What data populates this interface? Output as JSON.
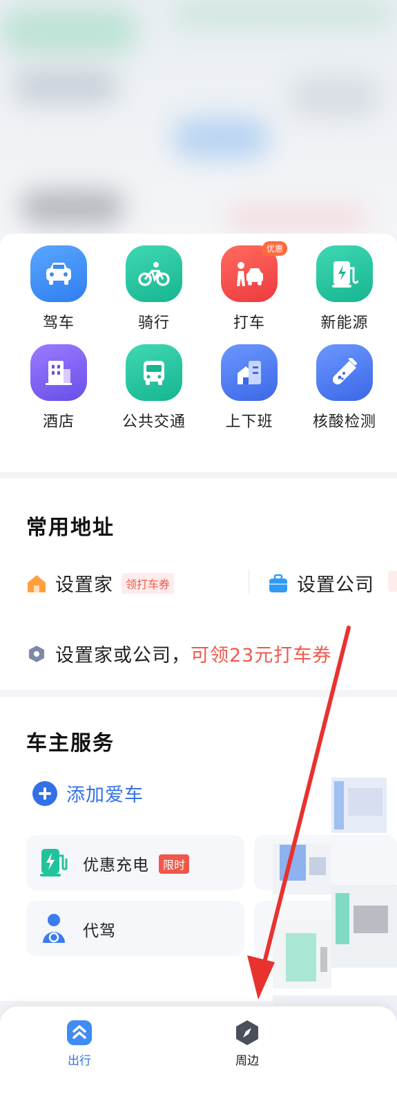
{
  "services": [
    {
      "label": "驾车",
      "icon": "car-icon",
      "color": "#3d8bf0"
    },
    {
      "label": "骑行",
      "icon": "bike-icon",
      "color": "#22c3a0"
    },
    {
      "label": "打车",
      "icon": "taxi-icon",
      "color": "#f5494d",
      "badge": "优惠"
    },
    {
      "label": "新能源",
      "icon": "charging-pile-icon",
      "color": "#22c3a0"
    },
    {
      "label": "酒店",
      "icon": "hotel-icon",
      "color": "#7a63f0"
    },
    {
      "label": "公共交通",
      "icon": "bus-icon",
      "color": "#22c3a0"
    },
    {
      "label": "上下班",
      "icon": "commute-icon",
      "color": "#4a78ee"
    },
    {
      "label": "核酸检测",
      "icon": "test-tube-icon",
      "color": "#4a78ee"
    }
  ],
  "addresses": {
    "title": "常用地址",
    "home_label": "设置家",
    "home_tag": "领打车券",
    "company_label": "设置公司",
    "hint_prefix": "设置家或公司，",
    "hint_highlight": "可领23元打车券"
  },
  "owner": {
    "title": "车主服务",
    "add_car": "添加爱车",
    "cards": [
      {
        "label": "优惠充电",
        "tag": "限时",
        "icon": "charging-icon"
      },
      {
        "label": "代驾",
        "icon": "designated-driver-icon"
      }
    ]
  },
  "tabbar": {
    "tabs": [
      {
        "label": "出行",
        "active": true,
        "icon": "travel-icon"
      },
      {
        "label": "周边",
        "active": false,
        "icon": "compass-icon"
      }
    ]
  },
  "colors": {
    "accent": "#3370e8",
    "red": "#f0584d",
    "arrow": "#e8322e"
  }
}
